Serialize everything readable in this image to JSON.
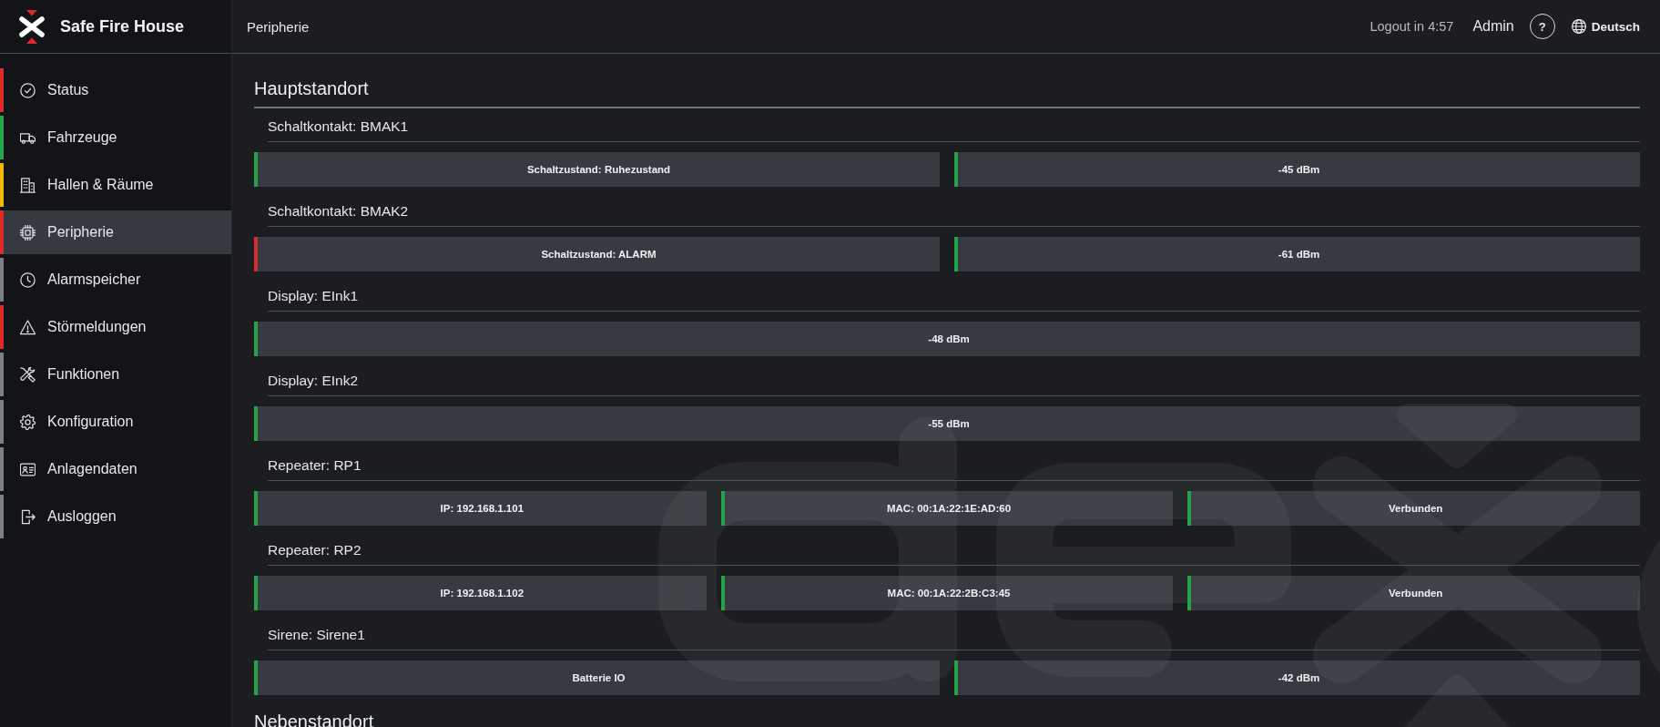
{
  "brand": {
    "title": "Safe Fire House"
  },
  "sidebar": {
    "items": [
      {
        "label": "Status",
        "color": "#e02b2b",
        "selected": false
      },
      {
        "label": "Fahrzeuge",
        "color": "#21a84a",
        "selected": false
      },
      {
        "label": "Hallen & Räume",
        "color": "#f2b705",
        "selected": false
      },
      {
        "label": "Peripherie",
        "color": "#e02b2b",
        "selected": true
      },
      {
        "label": "Alarmspeicher",
        "color": "#7a8087",
        "selected": false
      },
      {
        "label": "Störmeldungen",
        "color": "#e02b2b",
        "selected": false
      },
      {
        "label": "Funktionen",
        "color": "#7a8087",
        "selected": false
      },
      {
        "label": "Konfiguration",
        "color": "#7a8087",
        "selected": false
      },
      {
        "label": "Anlagendaten",
        "color": "#7a8087",
        "selected": false
      },
      {
        "label": "Ausloggen",
        "color": "#7a8087",
        "selected": false
      }
    ]
  },
  "header": {
    "title": "Peripherie",
    "logout_timer": "Logout in 4:57",
    "user": "Admin",
    "help": "?",
    "language": "Deutsch"
  },
  "sections": [
    {
      "title": "Hauptstandort",
      "devices": [
        {
          "title": "Schaltkontakt: BMAK1",
          "cells": [
            {
              "text": "Schaltzustand: Ruhezustand",
              "color": "#22a447"
            },
            {
              "text": "-45 dBm",
              "color": "#22a447"
            }
          ]
        },
        {
          "title": "Schaltkontakt: BMAK2",
          "cells": [
            {
              "text": "Schaltzustand: ALARM",
              "color": "#d42f2f"
            },
            {
              "text": "-61 dBm",
              "color": "#22a447"
            }
          ]
        },
        {
          "title": "Display: EInk1",
          "cells": [
            {
              "text": "-48 dBm",
              "color": "#22a447"
            }
          ]
        },
        {
          "title": "Display: EInk2",
          "cells": [
            {
              "text": "-55 dBm",
              "color": "#22a447"
            }
          ]
        },
        {
          "title": "Repeater: RP1",
          "cells": [
            {
              "text": "IP: 192.168.1.101",
              "color": "#22a447"
            },
            {
              "text": "MAC: 00:1A:22:1E:AD:60",
              "color": "#22a447"
            },
            {
              "text": "Verbunden",
              "color": "#22a447"
            }
          ]
        },
        {
          "title": "Repeater: RP2",
          "cells": [
            {
              "text": "IP: 192.168.1.102",
              "color": "#22a447"
            },
            {
              "text": "MAC: 00:1A:22:2B:C3:45",
              "color": "#22a447"
            },
            {
              "text": "Verbunden",
              "color": "#22a447"
            }
          ]
        },
        {
          "title": "Sirene: Sirene1",
          "cells": [
            {
              "text": "Batterie IO",
              "color": "#22a447"
            },
            {
              "text": "-42 dBm",
              "color": "#22a447"
            }
          ]
        }
      ]
    },
    {
      "title": "Nebenstandort"
    }
  ]
}
